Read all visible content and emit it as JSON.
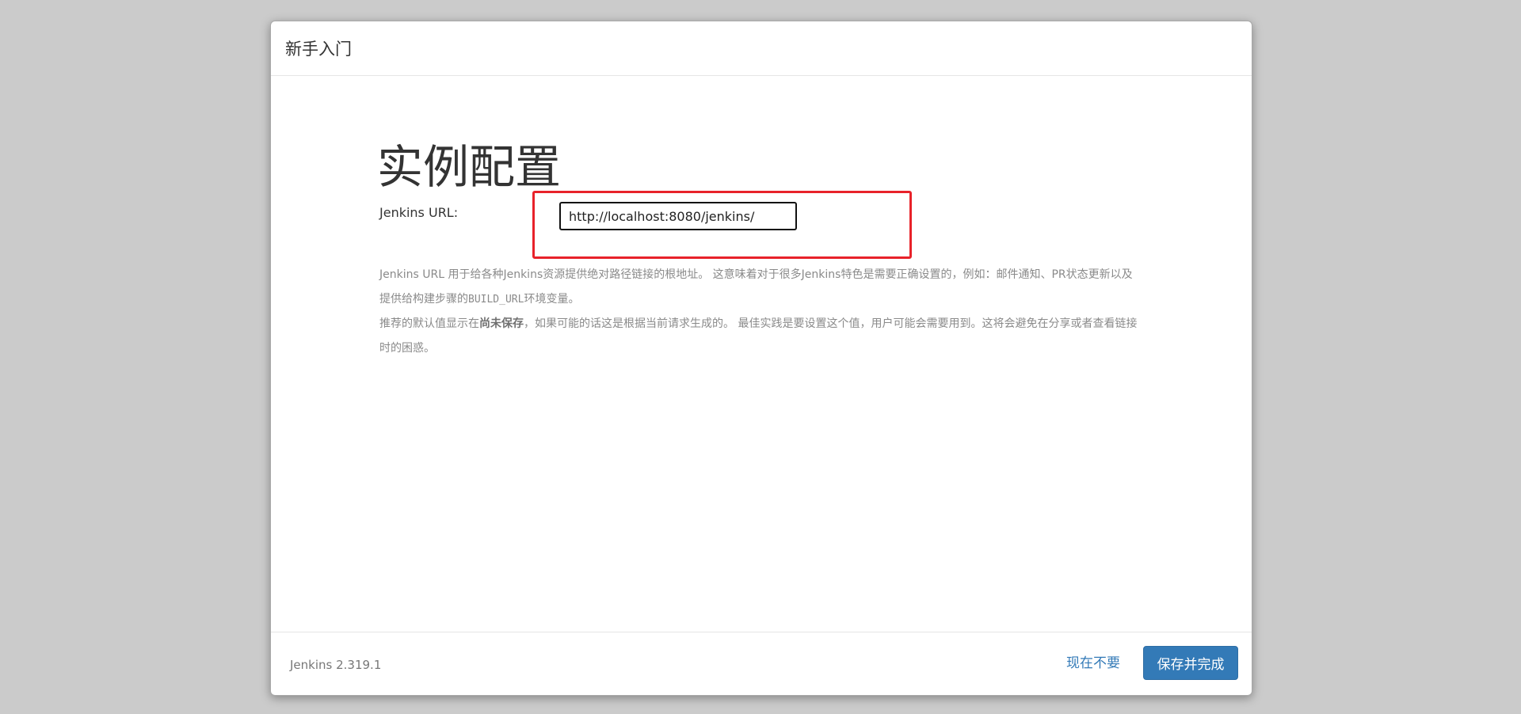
{
  "dialog": {
    "title": "新手入门"
  },
  "main": {
    "heading": "实例配置",
    "url_label": "Jenkins URL:",
    "url_value": "http://localhost:8080/jenkins/",
    "help": {
      "p1_part1": "Jenkins URL 用于给各种Jenkins资源提供绝对路径链接的根地址。 这意味着对于很多Jenkins特色是需要正确设置的，例如：邮件通知、PR状态更新以及提供给构建步骤的",
      "p1_code": "BUILD_URL",
      "p1_part2": "环境变量。",
      "p2_part1": "推荐的默认值显示在",
      "p2_bold": "尚未保存",
      "p2_part2": "，如果可能的话这是根据当前请求生成的。 最佳实践是要设置这个值，用户可能会需要用到。这将会避免在分享或者查看链接时的困惑。"
    }
  },
  "footer": {
    "version": "Jenkins 2.319.1",
    "skip_label": "现在不要",
    "save_label": "保存并完成"
  },
  "colors": {
    "accent": "#337ab7",
    "highlight": "#e8222a",
    "backdrop": "#cbcbcb"
  }
}
